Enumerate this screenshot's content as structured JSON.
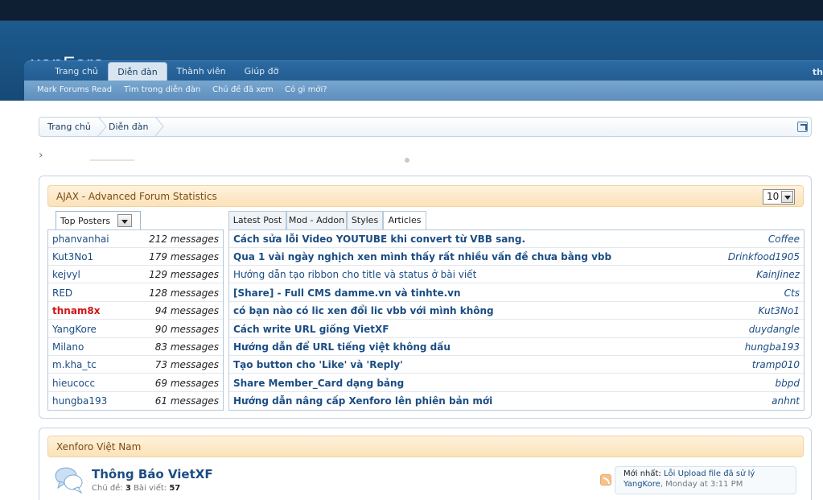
{
  "brand": {
    "logo_text": "xenForo"
  },
  "nav": {
    "tabs": [
      "Trang chủ",
      "Diễn đàn",
      "Thành viên",
      "Giúp đỡ"
    ],
    "right_text": "th",
    "subnav": [
      "Mark Forums Read",
      "Tìm trong diễn đàn",
      "Chủ đề đã xem",
      "Có gì mới?"
    ]
  },
  "breadcrumb": [
    "Trang chủ",
    "Diễn đàn"
  ],
  "stats": {
    "title": "AJAX - Advanced Forum Statistics",
    "count_value": "10",
    "left_tab": "Top Posters",
    "posters": [
      {
        "name": "phanvanhai",
        "count": "212 messages"
      },
      {
        "name": "Kut3No1",
        "count": "179 messages"
      },
      {
        "name": "kejvyl",
        "count": "129 messages"
      },
      {
        "name": "RED",
        "count": "128 messages"
      },
      {
        "name": "thnam8x",
        "count": "94 messages"
      },
      {
        "name": "YangKore",
        "count": "90 messages"
      },
      {
        "name": "Milano",
        "count": "83 messages"
      },
      {
        "name": "m.kha_tc",
        "count": "73 messages"
      },
      {
        "name": "hieucocc",
        "count": "69 messages"
      },
      {
        "name": "hungba193",
        "count": "61 messages"
      }
    ],
    "right_tabs": [
      "Latest Post",
      "Mod - Addon",
      "Styles",
      "Articles"
    ],
    "threads": [
      {
        "title": "Cách sửa lỗi Video YOUTUBE khi convert từ VBB sang.",
        "author": "Coffee"
      },
      {
        "title": "Qua 1 vài ngày nghịch xen mình thấy rất nhiều vấn đề chưa bằng vbb",
        "author": "Drinkfood1905"
      },
      {
        "title": "Hướng dẫn tạo ribbon cho title và status ở bài viết",
        "author": "KainJinez"
      },
      {
        "title": "[Share] - Full CMS damme.vn và tinhte.vn",
        "author": "Cts"
      },
      {
        "title": "có bạn nào có lic xen đổi lic vbb với mình không",
        "author": "Kut3No1"
      },
      {
        "title": "Cách write URL giống VietXF",
        "author": "duydangle"
      },
      {
        "title": "Hướng dẫn để URL tiếng việt không dấu",
        "author": "hungba193"
      },
      {
        "title": "Tạo button cho 'Like' và 'Reply'",
        "author": "tramp010"
      },
      {
        "title": "Share Member_Card dạng bảng",
        "author": "bbpd"
      },
      {
        "title": "Hướng dẫn nâng cấp Xenforo lên phiên bản mới",
        "author": "anhnt"
      }
    ]
  },
  "forum": {
    "category": "Xenforo Việt Nam",
    "title": "Thông Báo VietXF",
    "topics_label": "Chủ đề:",
    "topics_value": "3",
    "posts_label": "Bài viết:",
    "posts_value": "57",
    "latest_label": "Mới nhất:",
    "latest_title": "Lỗi Upload file đã sử lý",
    "latest_user": "YangKore",
    "latest_time": ", Monday at 3:11 PM"
  },
  "colors": {
    "header": "#1d5a8e",
    "link": "#1b4d84",
    "highlight_red": "#d01515",
    "panel_head": "#fbe2b8"
  }
}
